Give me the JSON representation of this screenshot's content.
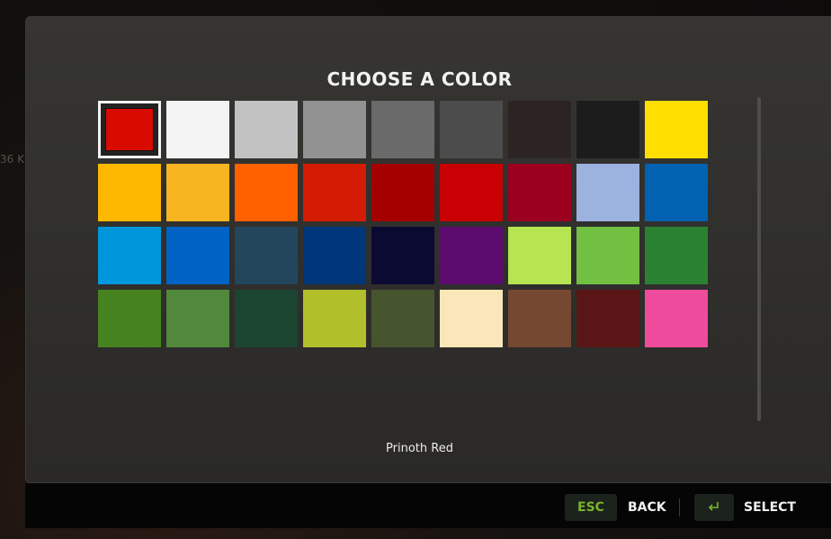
{
  "dialog": {
    "title": "CHOOSE A COLOR",
    "selected_color_name": "Prinoth Red"
  },
  "swatches": [
    {
      "color": "#d90b00",
      "selected": true
    },
    {
      "color": "#f4f4f4"
    },
    {
      "color": "#c2c2c2"
    },
    {
      "color": "#929292"
    },
    {
      "color": "#6a6a6a"
    },
    {
      "color": "#4c4c4c"
    },
    {
      "color": "#2c2423"
    },
    {
      "color": "#1c1c1c"
    },
    {
      "color": "#ffdf00"
    },
    {
      "color": "#ffb800"
    },
    {
      "color": "#f7b521"
    },
    {
      "color": "#ff6000"
    },
    {
      "color": "#d41c05"
    },
    {
      "color": "#a50000"
    },
    {
      "color": "#c80003"
    },
    {
      "color": "#9b001f"
    },
    {
      "color": "#9cb3e0"
    },
    {
      "color": "#0062b1"
    },
    {
      "color": "#0096dc"
    },
    {
      "color": "#0062c4"
    },
    {
      "color": "#23465d"
    },
    {
      "color": "#00377a"
    },
    {
      "color": "#0b0a33"
    },
    {
      "color": "#5c0c6e"
    },
    {
      "color": "#b6e551"
    },
    {
      "color": "#72c042"
    },
    {
      "color": "#2a8131"
    },
    {
      "color": "#46821f"
    },
    {
      "color": "#51883c"
    },
    {
      "color": "#1b4530"
    },
    {
      "color": "#b1bf2b"
    },
    {
      "color": "#46552e"
    },
    {
      "color": "#f9e6b9"
    },
    {
      "color": "#754832"
    },
    {
      "color": "#5a1616"
    },
    {
      "color": "#ef4b9c"
    }
  ],
  "footer": {
    "esc_key": "ESC",
    "back_label": "BACK",
    "enter_key_icon": "enter-key-icon",
    "select_label": "SELECT"
  },
  "colors": {
    "accent_green": "#7ab32e",
    "dialog_bg": "#2f2e2c",
    "footer_bg": "#050505"
  }
}
